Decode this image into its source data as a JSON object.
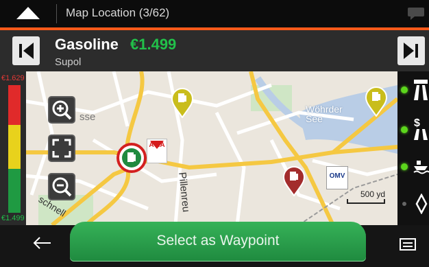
{
  "header": {
    "title": "Map Location (3/62)",
    "accent_color": "#ff5a1a",
    "home_icon": "up-arrow-home-icon",
    "chat_icon": "speech-bubble-icon"
  },
  "fuel_info": {
    "fuel_type": "Gasoline",
    "price": "€1.499",
    "station": "Supol",
    "price_color": "#22c04a"
  },
  "price_scale": {
    "max": "€1.629",
    "min": "€1.499",
    "max_color": "#e53935",
    "min_color": "#22c04a"
  },
  "map": {
    "labels": {
      "street_fragment_1": "sse",
      "lake_name": "Wöhrder See",
      "street_fragment_2": "Pillenreu",
      "street_fragment_3": "schnell"
    },
    "brands": {
      "avia": "AVIA",
      "omv": "OMV"
    },
    "scale_label": "500 yd"
  },
  "controls": {
    "zoom_in": "zoom-in-icon",
    "fit": "fit-view-icon",
    "zoom_out": "zoom-out-icon"
  },
  "action": {
    "button_label": "Select as Waypoint",
    "back_icon": "back-arrow-icon",
    "menu_icon": "menu-icon"
  }
}
